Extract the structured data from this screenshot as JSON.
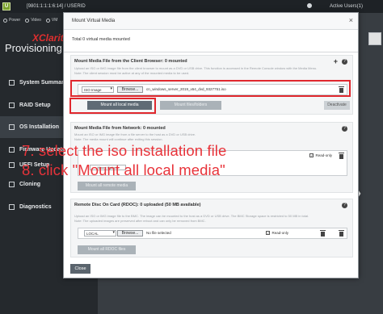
{
  "topbar": {
    "logo": "U",
    "ip": "[9801:1:1:1:6:14] / USERID",
    "status": "Active Users(1)"
  },
  "sidebar": {
    "tools": [
      "Power",
      "Video",
      "VM"
    ],
    "brand": "XClarity",
    "product": "Provisioning Manager",
    "items": [
      {
        "label": "System Summary",
        "active": false
      },
      {
        "label": "RAID Setup",
        "active": false
      },
      {
        "label": "OS Installation",
        "active": true
      },
      {
        "label": "Firmware Update",
        "active": false
      },
      {
        "label": "UEFI Setup",
        "active": false
      },
      {
        "label": "Cloning",
        "active": false
      },
      {
        "label": "Diagnostics",
        "active": false
      }
    ]
  },
  "modal": {
    "title": "Mount Virtual Media",
    "close_icon": "×",
    "status": "Total 0 virtual media mounted",
    "client": {
      "title": "Mount Media File from the Client Browser: 0 mounted",
      "desc": "Upload an ISO or IMG image file from the client browser to mount as a DVD or USB drive. This function is accessed in the Remote Console window with the Media Menu.",
      "desc2": "Note: The client session must be active at any of the mounted media to be used.",
      "type": "ISO Image",
      "browse": "Browse...",
      "file": "cn_windows_server_2019_x64_dvd_9327751.iso",
      "mount_all": "Mount all local media",
      "mount_folders": "Mount files/folders",
      "deactivate": "Deactivate"
    },
    "network": {
      "title": "Mount Media File from Network: 0 mounted",
      "desc": "Mount an ISO or IMG image file from a file server to the host as a DVD or USB drive.",
      "desc2": "Note: The media mount will continue after exiting this session.",
      "readonly": "Read-only",
      "options": "Mount Options",
      "mount_all": "Mount all remote media"
    },
    "rdoc": {
      "title": "Remote Disc On Card (RDOC): 0 uploaded (50 MB available)",
      "desc": "Upload an ISO or IMG image file to the BMC. The image can be mounted to the host as a DVD or USB drive. The BMC Storage space is restricted to 50 MB in total.",
      "desc2": "Note: The uploaded images are preserved after reboot and can only be removed from BMC.",
      "type": "LOCAL",
      "browse": "Browse...",
      "file": "No file selected",
      "readonly": "Read-only",
      "mount_all": "Mount all RDOC files"
    },
    "close": "Close"
  },
  "annotations": {
    "line1": "7. select the iso installation file",
    "line2": "8. click \"Mount all local media\""
  },
  "colors": {
    "annotation": "#e8333a",
    "highlight_box": "#e0282e",
    "brand_red": "#e02f2f"
  },
  "icons": [
    "power-icon",
    "video-icon",
    "vm-icon",
    "plus-icon",
    "help-icon",
    "trash-icon",
    "close-icon",
    "chevron-right-icon"
  ]
}
